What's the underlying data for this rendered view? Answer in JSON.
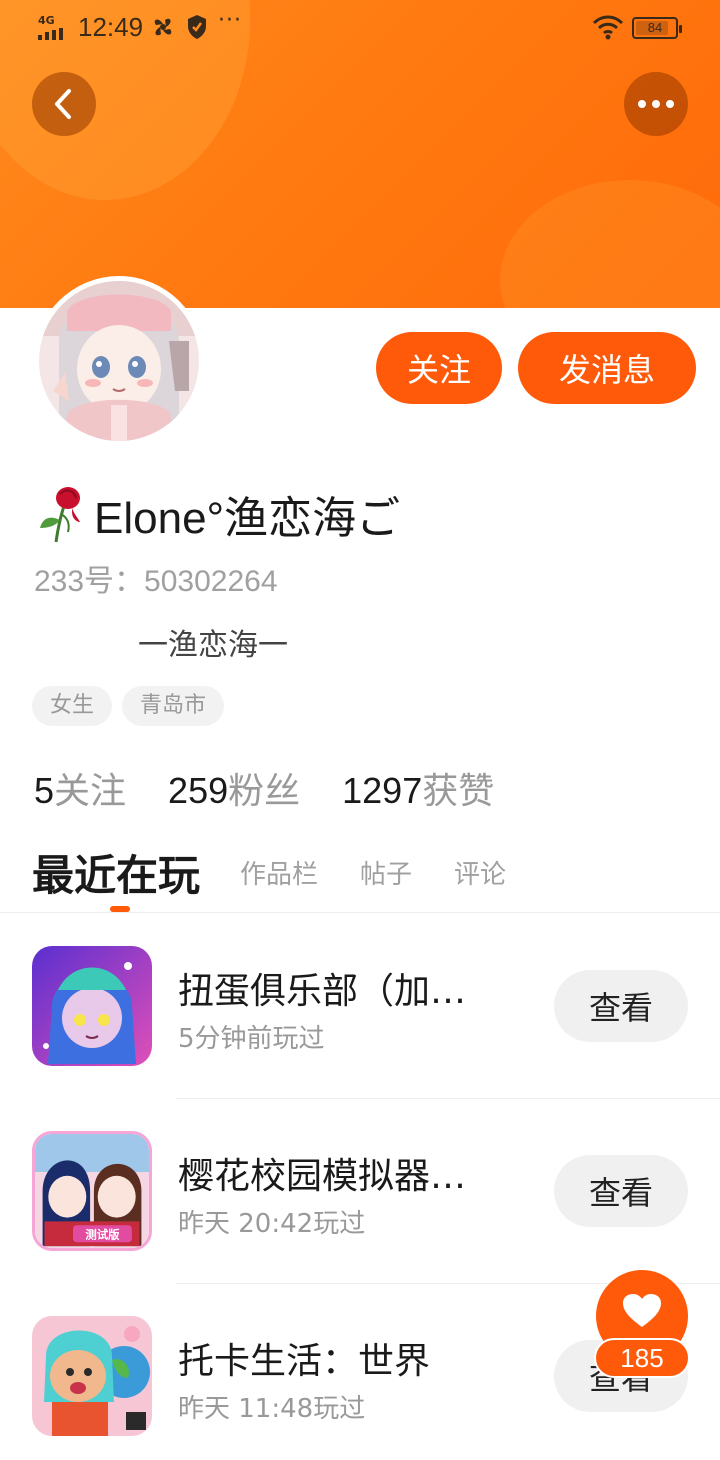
{
  "status_bar": {
    "network": "4G",
    "time": "12:49",
    "more": "···",
    "battery": "84",
    "battery_level": 0.84
  },
  "header": {
    "back_icon": "chevron-left-icon",
    "more_icon": "more-dots-icon",
    "accent_color": "#ff7a10"
  },
  "profile": {
    "follow_label": "关注",
    "message_label": "发消息",
    "nickname": "Elone°渔恋海ご",
    "user_id": "233号：50302264",
    "bio": "一渔恋海一",
    "tags": [
      "女生",
      "青岛市"
    ]
  },
  "stats": [
    {
      "num": "5",
      "label": "关注"
    },
    {
      "num": "259",
      "label": "粉丝"
    },
    {
      "num": "1297",
      "label": "获赞"
    }
  ],
  "tabs": [
    {
      "label": "最近在玩",
      "active": true
    },
    {
      "label": "作品栏",
      "active": false
    },
    {
      "label": "帖子",
      "active": false
    },
    {
      "label": "评论",
      "active": false
    }
  ],
  "games": [
    {
      "title": "扭蛋俱乐部（加…",
      "subtitle": "5分钟前玩过",
      "button": "查看"
    },
    {
      "title": "樱花校园模拟器…",
      "subtitle": "昨天 20:42玩过",
      "button": "查看"
    },
    {
      "title": "托卡生活：世界",
      "subtitle": "昨天 11:48玩过",
      "button": "查看"
    }
  ],
  "like_fab": {
    "count": "185",
    "icon": "heart-icon"
  }
}
